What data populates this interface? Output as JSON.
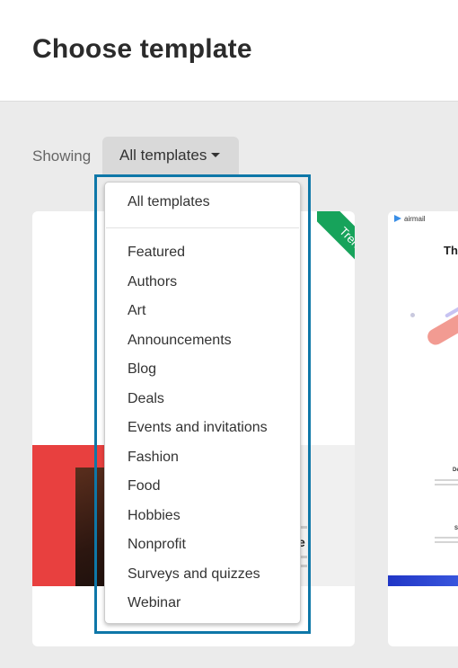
{
  "header": {
    "title": "Choose template"
  },
  "filter": {
    "showing_label": "Showing",
    "selected": "All templates",
    "options": [
      "All templates",
      "Featured",
      "Authors",
      "Art",
      "Announcements",
      "Blog",
      "Deals",
      "Events and invitations",
      "Fashion",
      "Food",
      "Hobbies",
      "Nonprofit",
      "Surveys and quizzes",
      "Webinar"
    ]
  },
  "cards": [
    {
      "badge": "Trending",
      "heading_fragment": "e"
    },
    {
      "logo": "airmail",
      "title_fragment": "Th",
      "fragment_1": "De",
      "fragment_2": "Sc"
    }
  ],
  "colors": {
    "dropdown_highlight": "#0e77a8",
    "badge": "#17a35b",
    "card_red": "#e8403f",
    "card_blue": "#2036c6"
  },
  "icons": {
    "caret": "caret-down-icon",
    "airmail_logo": "paper-plane-icon"
  }
}
